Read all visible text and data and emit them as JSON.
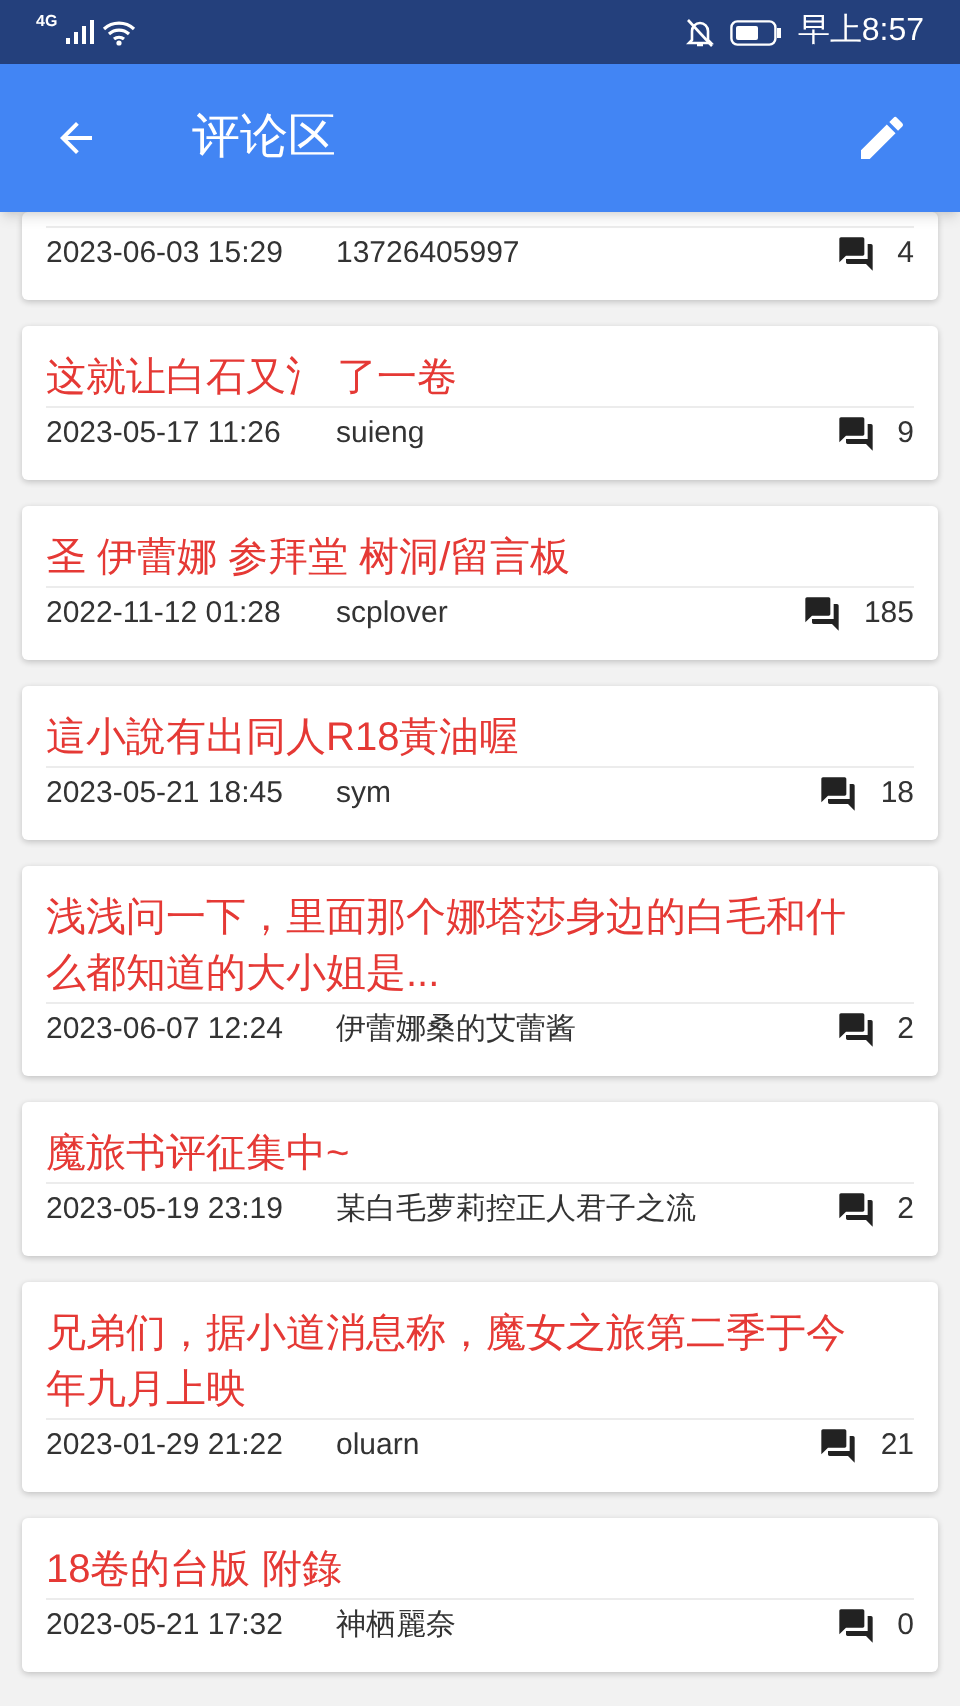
{
  "status_bar": {
    "network": "4G",
    "time": "早上8:57"
  },
  "app_bar": {
    "title": "评论区"
  },
  "posts": [
    {
      "date": "2023-06-03 15:29",
      "author": "13726405997",
      "comments": "4"
    },
    {
      "title": "这就让白石又氵 了一卷",
      "date": "2023-05-17 11:26",
      "author": "suieng",
      "comments": "9"
    },
    {
      "title": "圣 伊蕾娜 参拜堂 树洞/留言板",
      "date": "2022-11-12 01:28",
      "author": "scplover",
      "comments": "185"
    },
    {
      "title": "這小說有出同人R18黃油喔",
      "date": "2023-05-21 18:45",
      "author": "sym",
      "comments": "18"
    },
    {
      "title": "浅浅问一下，里面那个娜塔莎身边的白毛和什么都知道的大小姐是...",
      "date": "2023-06-07 12:24",
      "author": "伊蕾娜桑的艾蕾酱",
      "comments": "2"
    },
    {
      "title": "魔旅书评征集中~",
      "date": "2023-05-19 23:19",
      "author": "某白毛萝莉控正人君子之流",
      "comments": "2"
    },
    {
      "title": "兄弟们，据小道消息称，魔女之旅第二季于今年九月上映",
      "date": "2023-01-29 21:22",
      "author": "oluarn",
      "comments": "21"
    },
    {
      "title": "18卷的台版 附錄",
      "date": "2023-05-21 17:32",
      "author": "神栖麗奈",
      "comments": "0"
    }
  ]
}
